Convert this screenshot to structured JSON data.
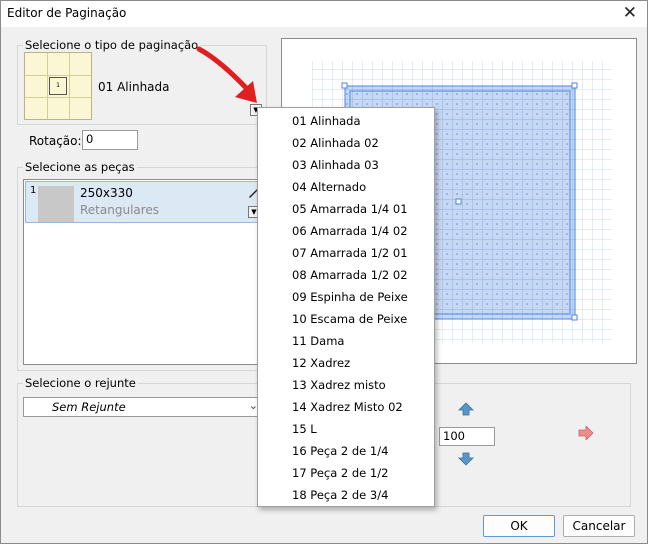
{
  "window": {
    "title": "Editor de Paginação"
  },
  "pagination_group": {
    "legend": "Selecione o tipo de paginação",
    "selected": "01 Alinhada",
    "thumb_glyph": "1",
    "rotation_label": "Rotação:",
    "rotation_value": "0"
  },
  "pieces_group": {
    "legend": "Selecione as peças",
    "items": [
      {
        "index": "1",
        "size": "250x330",
        "type": "Retangulares"
      }
    ]
  },
  "grout_group": {
    "legend": "Selecione o rejunte",
    "value": "Sem Rejunte"
  },
  "zoom": {
    "value": "100"
  },
  "dropdown": {
    "options": [
      "01 Alinhada",
      "02 Alinhada 02",
      "03 Alinhada 03",
      "04 Alternado",
      "05 Amarrada 1/4 01",
      "06 Amarrada 1/4 02",
      "07 Amarrada 1/2 01",
      "08 Amarrada 1/2 02",
      "09 Espinha de Peixe",
      "10 Escama de Peixe",
      "11 Dama",
      "12 Xadrez",
      "13 Xadrez misto",
      "14 Xadrez Misto 02",
      "15 L",
      "16 Peça 2 de 1/4",
      "17 Peça 2 de 1/2",
      "18 Peça 2 de 3/4"
    ]
  },
  "buttons": {
    "ok": "OK",
    "cancel": "Cancelar"
  },
  "colors": {
    "accent_blue": "#4a86e8",
    "tile_fill": "#c6d8f4",
    "arrow_red": "#e02020",
    "thumb_fill": "#fbf7d4"
  },
  "icons": [
    "close-icon",
    "dropdown-arrow-icon",
    "edit-pencil-icon",
    "arrow-up-icon",
    "arrow-down-icon",
    "arrow-right-icon",
    "red-pointer-arrow-icon"
  ]
}
